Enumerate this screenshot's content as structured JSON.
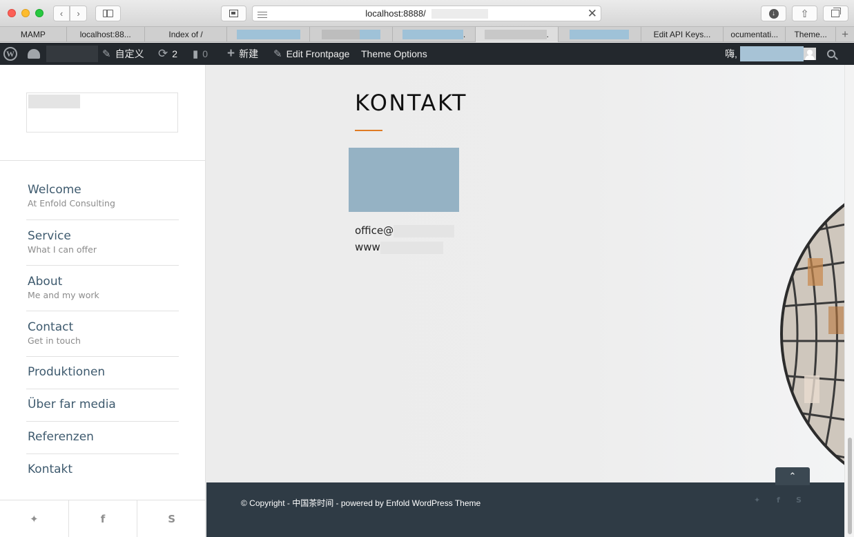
{
  "browser": {
    "address": "localhost:8888/",
    "tabs": [
      "MAMP",
      "localhost:88...",
      "Index of /",
      "",
      "",
      ".",
      ".",
      "",
      "Edit API Keys...",
      "ocumentati...",
      "Theme..."
    ],
    "add_tab": "+"
  },
  "adminbar": {
    "customize": "自定义",
    "updates_count": "2",
    "comments_count": "0",
    "new_label": "新建",
    "edit_frontpage": "Edit Frontpage",
    "theme_options": "Theme Options",
    "greeting": "嗨,"
  },
  "sidebar": {
    "nav": [
      {
        "title": "Welcome",
        "sub": "At Enfold Consulting"
      },
      {
        "title": "Service",
        "sub": "What I can offer"
      },
      {
        "title": "About",
        "sub": "Me and my work"
      },
      {
        "title": "Contact",
        "sub": "Get in touch"
      },
      {
        "title": "Produktionen"
      },
      {
        "title": "Über far media"
      },
      {
        "title": "Referenzen"
      },
      {
        "title": "Kontakt"
      }
    ],
    "social": [
      "twitter-icon",
      "facebook-icon",
      "skype-icon"
    ]
  },
  "main": {
    "title": "KONTAKT",
    "email_prefix": "office@",
    "web_prefix": "www"
  },
  "footer": {
    "copyright": "© Copyright - 中国茶时间 - powered by Enfold WordPress Theme",
    "scroll_top": "⌃"
  },
  "colors": {
    "accent_orange": "#e07b24",
    "nav_link": "#3e5a6e",
    "adminbar_bg": "#23282d",
    "footer_bg": "#2f3b45",
    "image_placeholder": "#95b2c4"
  }
}
